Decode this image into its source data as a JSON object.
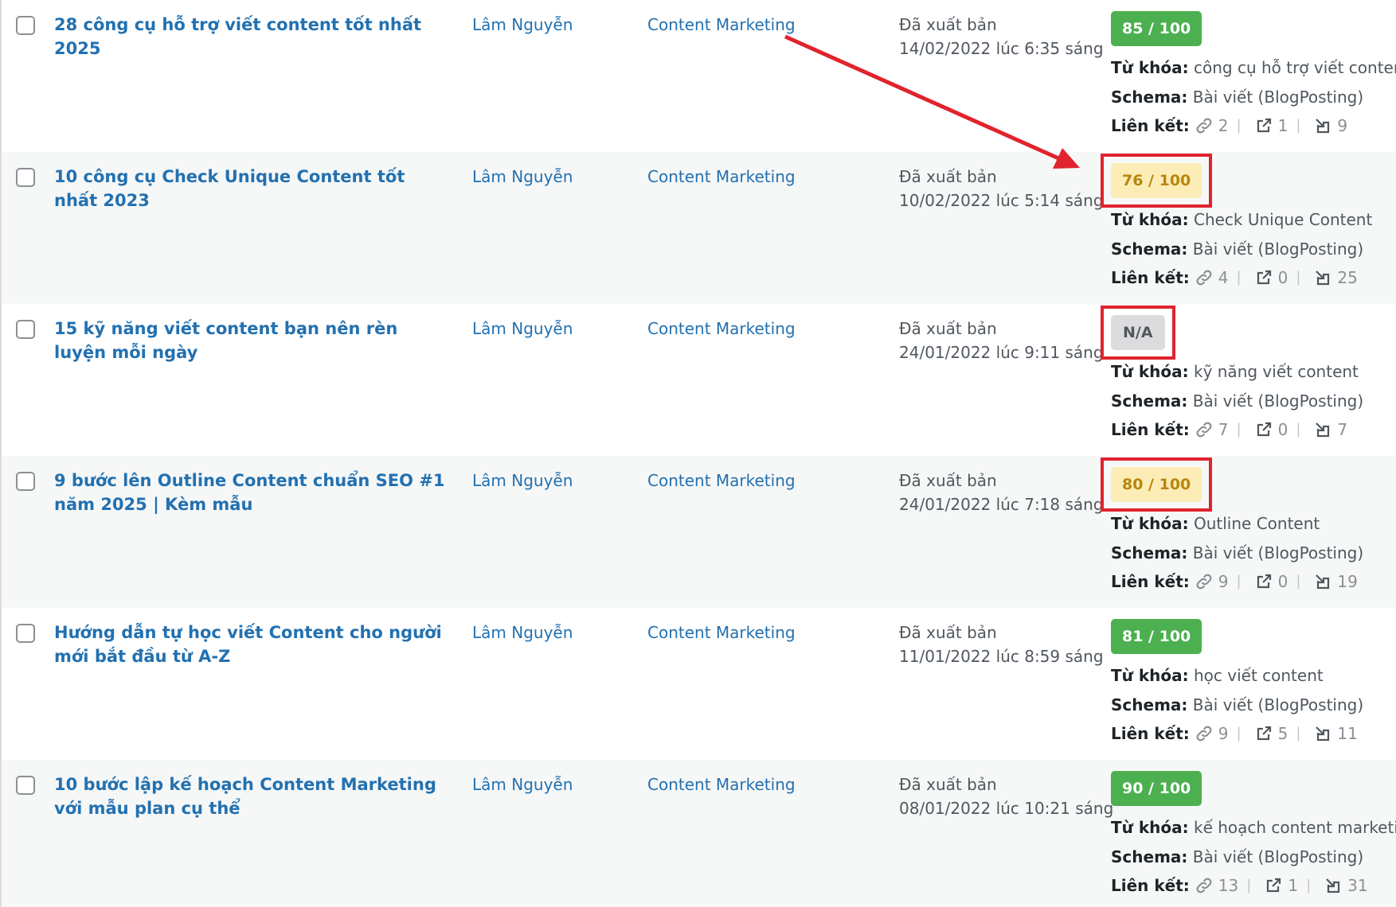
{
  "labels": {
    "keyword": "Từ khóa:",
    "schema": "Schema:",
    "links": "Liên kết:",
    "link_icon": "link-icon",
    "external_icon": "external-link-icon",
    "incoming_icon": "incoming-link-icon"
  },
  "colors": {
    "link": "#2271b1",
    "score_good": "#4cb050",
    "score_ok_bg": "#fcedb7",
    "score_ok_text": "#b8860b",
    "score_na_bg": "#dcdcde",
    "annotation_red": "#e0232d"
  },
  "rows": [
    {
      "title": "28 công cụ hỗ trợ viết content tốt nhất 2025",
      "author": "Lâm Nguyễn",
      "category": "Content Marketing",
      "status": "Đã xuất bản",
      "date": "14/02/2022 lúc 6:35 sáng",
      "score": "85 / 100",
      "score_level": "good",
      "keyword": "công cụ hỗ trợ viết content",
      "schema": "Bài viết (BlogPosting)",
      "internal_links": "2",
      "external_links": "1",
      "incoming_links": "9"
    },
    {
      "title": "10 công cụ Check Unique Content tốt nhất 2023",
      "author": "Lâm Nguyễn",
      "category": "Content Marketing",
      "status": "Đã xuất bản",
      "date": "10/02/2022 lúc 5:14 sáng",
      "score": "76 / 100",
      "score_level": "ok",
      "keyword": "Check Unique Content",
      "schema": "Bài viết (BlogPosting)",
      "internal_links": "4",
      "external_links": "0",
      "incoming_links": "25"
    },
    {
      "title": "15 kỹ năng viết content bạn nên rèn luyện mỗi ngày",
      "author": "Lâm Nguyễn",
      "category": "Content Marketing",
      "status": "Đã xuất bản",
      "date": "24/01/2022 lúc 9:11 sáng",
      "score": "N/A",
      "score_level": "na",
      "keyword": "kỹ năng viết content",
      "schema": "Bài viết (BlogPosting)",
      "internal_links": "7",
      "external_links": "0",
      "incoming_links": "7"
    },
    {
      "title": "9 bước lên Outline Content chuẩn SEO #1 năm 2025 | Kèm mẫu",
      "author": "Lâm Nguyễn",
      "category": "Content Marketing",
      "status": "Đã xuất bản",
      "date": "24/01/2022 lúc 7:18 sáng",
      "score": "80 / 100",
      "score_level": "ok",
      "keyword": "Outline Content",
      "schema": "Bài viết (BlogPosting)",
      "internal_links": "9",
      "external_links": "0",
      "incoming_links": "19"
    },
    {
      "title": "Hướng dẫn tự học viết Content cho người mới bắt đầu từ A-Z",
      "author": "Lâm Nguyễn",
      "category": "Content Marketing",
      "status": "Đã xuất bản",
      "date": "11/01/2022 lúc 8:59 sáng",
      "score": "81 / 100",
      "score_level": "good",
      "keyword": "học viết content",
      "schema": "Bài viết (BlogPosting)",
      "internal_links": "9",
      "external_links": "5",
      "incoming_links": "11"
    },
    {
      "title": "10 bước lập kế hoạch Content Marketing với mẫu plan cụ thể",
      "author": "Lâm Nguyễn",
      "category": "Content Marketing",
      "status": "Đã xuất bản",
      "date": "08/01/2022 lúc 10:21 sáng",
      "score": "90 / 100",
      "score_level": "good",
      "keyword": "kế hoạch content marketing",
      "schema": "Bài viết (BlogPosting)",
      "internal_links": "13",
      "external_links": "1",
      "incoming_links": "31"
    }
  ]
}
